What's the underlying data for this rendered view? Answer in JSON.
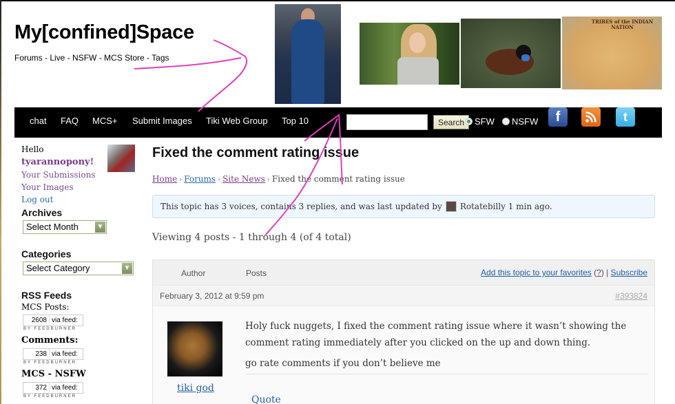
{
  "site": {
    "title": "My[confined]Space",
    "top_links": [
      "Forums",
      "Live",
      "NSFW",
      "MCS Store",
      "Tags"
    ],
    "top_links_separator": " - "
  },
  "header_images": [
    {
      "name": "superhero-photo"
    },
    {
      "name": "woman-portrait-photo"
    },
    {
      "name": "duck-photo"
    },
    {
      "name": "indian-nation-map",
      "caption": "TRIBES of the INDIAN NATION"
    }
  ],
  "navbar": {
    "items": [
      "chat",
      "FAQ",
      "MCS+",
      "Submit Images",
      "Tiki Web Group",
      "Top 10"
    ],
    "search": {
      "value": "",
      "placeholder": "",
      "button_label": "Search"
    },
    "mode_options": [
      {
        "label": "SFW",
        "selected": true
      },
      {
        "label": "NSFW",
        "selected": false
      }
    ],
    "social": [
      {
        "name": "facebook",
        "glyph": "f"
      },
      {
        "name": "rss",
        "glyph": "◥"
      },
      {
        "name": "twitter",
        "glyph": "t"
      }
    ]
  },
  "sidebar": {
    "greeting": "Hello",
    "username": "tyarannopony!",
    "links": [
      "Your Submissions",
      "Your Images",
      "Log out"
    ],
    "archives": {
      "heading": "Archives",
      "select_value": "Select Month"
    },
    "categories": {
      "heading": "Categories",
      "select_value": "Select Category"
    },
    "rss": {
      "heading": "RSS Feeds",
      "feeds": [
        {
          "label": "MCS Posts:",
          "count": "2608",
          "via": "via feed:",
          "by": "BY FEEDBURNER"
        },
        {
          "label": "Comments:",
          "count": "238",
          "via": "via feed:",
          "by": "BY FEEDBURNER"
        },
        {
          "label": "MCS - NSFW",
          "count": "372",
          "via": "via feed:",
          "by": "BY FEEDBURNER"
        }
      ]
    }
  },
  "topic": {
    "title": "Fixed the comment rating issue",
    "breadcrumb": [
      "Home",
      "Forums",
      "Site News",
      "Fixed the comment rating issue"
    ],
    "breadcrumb_separator": "›",
    "info_prefix": "This topic has 3 voices, contains 3 replies, and was last updated by",
    "info_user": "Rotatebilly",
    "info_suffix": "1 min ago.",
    "viewing": "Viewing 4 posts - 1 through 4 (of 4 total)",
    "table": {
      "col_author": "Author",
      "col_posts": "Posts",
      "favorites_link": "Add this topic to your favorites",
      "help_open": "(",
      "help_link": "?",
      "help_close": ")",
      "divider": "|",
      "subscribe_link": "Subscribe"
    },
    "posts": [
      {
        "date": "February 3, 2012 at 9:59 pm",
        "permalink": "#393824",
        "author": "tiki god",
        "paragraphs": [
          "Holy fuck nuggets, I fixed the comment rating issue where it wasn’t showing the comment rating immediately after you clicked on the up and down thing.",
          "go rate comments if you don’t believe me"
        ],
        "quote_label": "Quote"
      }
    ]
  }
}
